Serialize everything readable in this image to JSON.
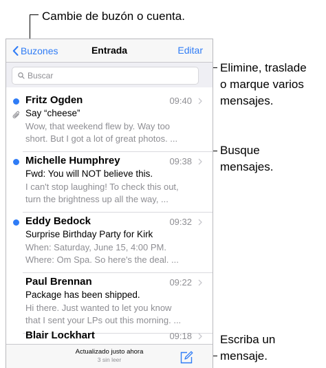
{
  "callouts": {
    "mailbox": "Cambie de buzón o cuenta.",
    "edit": [
      "Elimine, traslade",
      "o marque varios",
      "mensajes."
    ],
    "search": [
      "Busque",
      "mensajes."
    ],
    "compose": [
      "Escriba un",
      "mensaje."
    ]
  },
  "navbar": {
    "back_label": "Buzones",
    "title": "Entrada",
    "edit_label": "Editar"
  },
  "search": {
    "placeholder": "Buscar"
  },
  "messages": [
    {
      "sender": "Fritz Ogden",
      "time": "09:40",
      "subject": "Say “cheese”",
      "preview1": "Wow, that weekend flew by. Way too",
      "preview2": "short. But I got a lot of great photos. ..."
    },
    {
      "sender": "Michelle Humphrey",
      "time": "09:38",
      "subject": "Fwd: You will NOT believe this.",
      "preview1": "I can't stop laughing! To check this out,",
      "preview2": "turn the brightness up all the way, ..."
    },
    {
      "sender": "Eddy Bedock",
      "time": "09:32",
      "subject": "Surprise Birthday Party for Kirk",
      "preview1": "When: Saturday, June 15, 4:00 PM.",
      "preview2": "Where: Om Spa. So here's the deal. ..."
    },
    {
      "sender": "Paul Brennan",
      "time": "09:22",
      "subject": "Package has been shipped.",
      "preview1": "Hi there. Just wanted to let you know",
      "preview2": "that I sent your LPs out this morning. ..."
    },
    {
      "sender": "Blair Lockhart",
      "time": "09:18"
    }
  ],
  "toolbar": {
    "status": "Actualizado justo ahora",
    "unread": "3 sin leer"
  },
  "colors": {
    "accent": "#2f7cf6",
    "unread_dot": "#2f7cf6",
    "secondary_text": "#8e8e93",
    "bar_background": "#f7f7f7"
  },
  "icons": {
    "back": "chevron-left-icon",
    "search": "search-icon",
    "attachment": "paperclip-icon",
    "disclosure": "chevron-right-icon",
    "compose": "compose-icon"
  }
}
